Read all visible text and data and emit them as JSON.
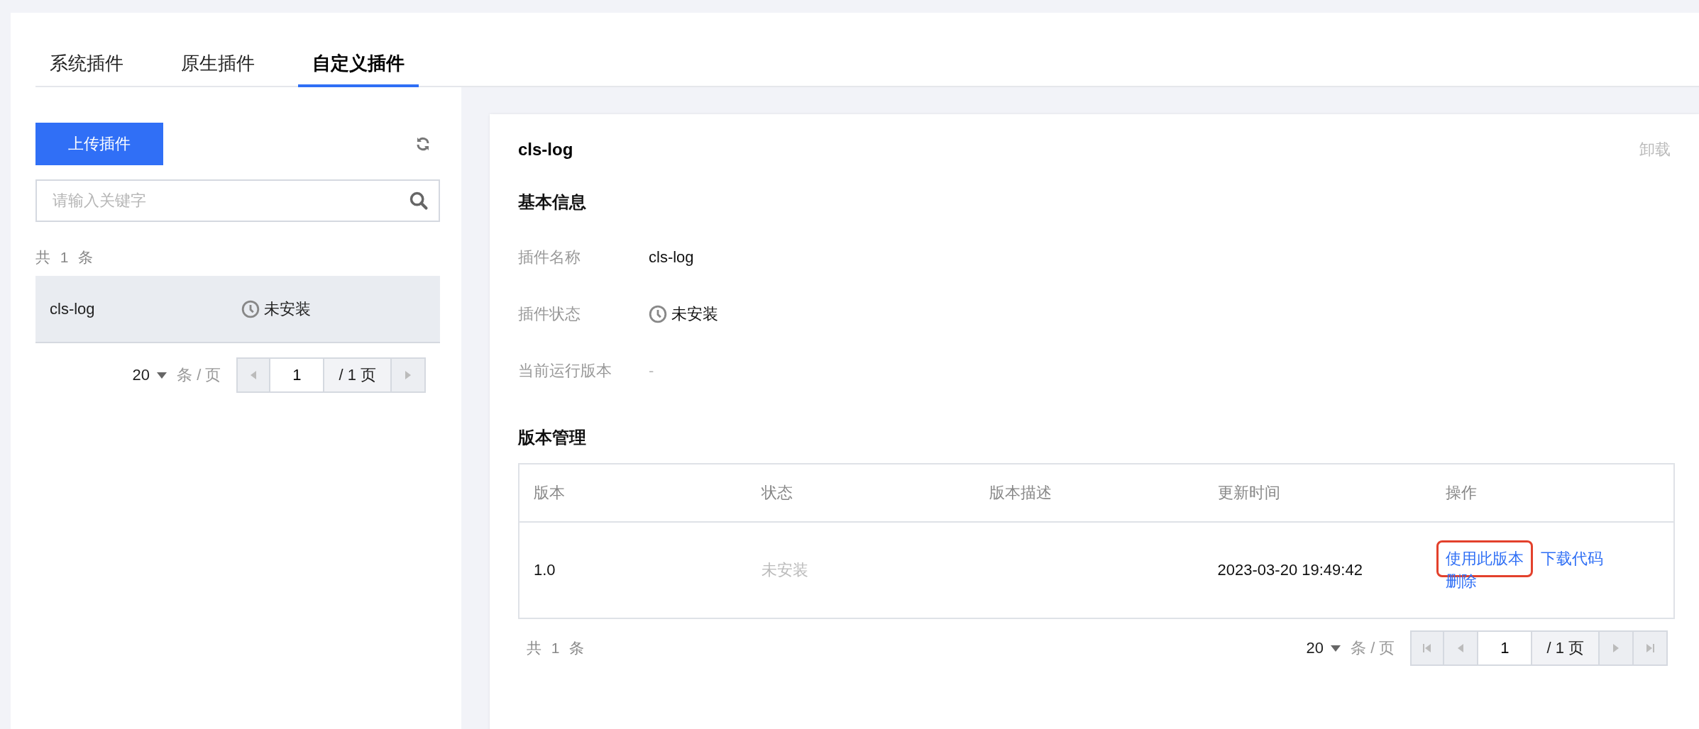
{
  "tabs": [
    {
      "label": "系统插件",
      "selected": false
    },
    {
      "label": "原生插件",
      "selected": false
    },
    {
      "label": "自定义插件",
      "selected": true
    }
  ],
  "sidebar": {
    "upload_button": "上传插件",
    "search": {
      "placeholder": "请输入关键字"
    },
    "total": "共 1 条",
    "items": [
      {
        "name": "cls-log",
        "status": "未安装",
        "selected": true
      }
    ],
    "pagination": {
      "page_size": "20",
      "per_page_label": "条 / 页",
      "page": "1",
      "total_pages": "/ 1 页"
    }
  },
  "detail": {
    "title": "cls-log",
    "uninstall_button": "卸载",
    "basic_heading": "基本信息",
    "fields": [
      {
        "label": "插件名称",
        "value": "cls-log",
        "kind": "text"
      },
      {
        "label": "插件状态",
        "value": "未安装",
        "kind": "status"
      },
      {
        "label": "当前运行版本",
        "value": "-",
        "kind": "empty"
      }
    ],
    "versions_heading": "版本管理",
    "table": {
      "columns": [
        "版本",
        "状态",
        "版本描述",
        "更新时间",
        "操作"
      ],
      "rows": [
        {
          "version": "1.0",
          "status": "未安装",
          "description": "",
          "updated": "2023-03-20 19:49:42",
          "actions": [
            {
              "label": "使用此版本",
              "highlighted": true
            },
            {
              "label": "下载代码",
              "highlighted": false
            },
            {
              "label": "删除",
              "highlighted": false
            }
          ]
        }
      ]
    },
    "total": "共 1 条",
    "pagination": {
      "page_size": "20",
      "per_page_label": "条 / 页",
      "page": "1",
      "total_pages": "/ 1 页"
    }
  }
}
